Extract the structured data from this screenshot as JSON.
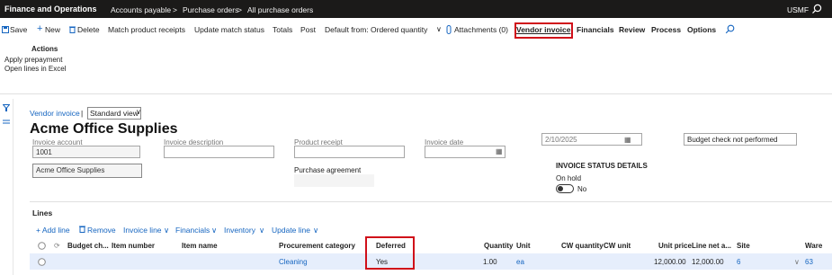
{
  "topbar": {
    "app_title": "Finance and Operations",
    "breadcrumbs": [
      "Accounts payable",
      "Purchase orders",
      "All purchase orders"
    ],
    "separator": ">",
    "company": "USMF"
  },
  "actionbar": {
    "save": "Save",
    "new": "New",
    "delete": "Delete",
    "match_receipts": "Match product receipts",
    "update_match_status": "Update match status",
    "totals": "Totals",
    "post": "Post",
    "default_from": "Default from: Ordered quantity",
    "attachments": "Attachments (0)",
    "tabs": [
      "Vendor invoice",
      "Financials",
      "Review",
      "Process",
      "Options"
    ]
  },
  "actions_group": {
    "title": "Actions",
    "items": [
      "Apply prepayment",
      "Open lines in Excel"
    ]
  },
  "form": {
    "view_link": "Vendor invoice",
    "view_name": "Standard view",
    "title": "Acme Office Supplies",
    "labels": {
      "invoice_account": "Invoice account",
      "invoice_description": "Invoice description",
      "product_receipt": "Product receipt",
      "invoice_date": "Invoice date",
      "purchase_agreement": "Purchase agreement"
    },
    "invoice_account_value": "1001",
    "vendor_name_value": "Acme Office Supplies",
    "date_value": "2/10/2025",
    "budget_status": "Budget check not performed",
    "status_details_title": "INVOICE STATUS DETAILS",
    "on_hold_label": "On hold",
    "on_hold_value": "No"
  },
  "lines": {
    "title": "Lines",
    "toolbar": [
      "+ Add line",
      "Remove",
      "Invoice line",
      "Financials",
      "Inventory",
      "Update line"
    ],
    "columns": [
      "Budget ch...",
      "Item number",
      "Item name",
      "Procurement category",
      "Deferred",
      "Quantity",
      "Unit",
      "CW quantity",
      "CW unit",
      "Unit price",
      "Line net a...",
      "Site",
      "Ware"
    ],
    "row": {
      "category": "Cleaning",
      "deferred": "Yes",
      "quantity": "1.00",
      "unit": "ea",
      "unit_price": "12,000.00",
      "line_net": "12,000.00",
      "site": "6",
      "warehouse": "63"
    }
  },
  "colors": {
    "accent": "#1565c0",
    "highlight": "#d0101a",
    "topbar": "#1b1a19"
  }
}
